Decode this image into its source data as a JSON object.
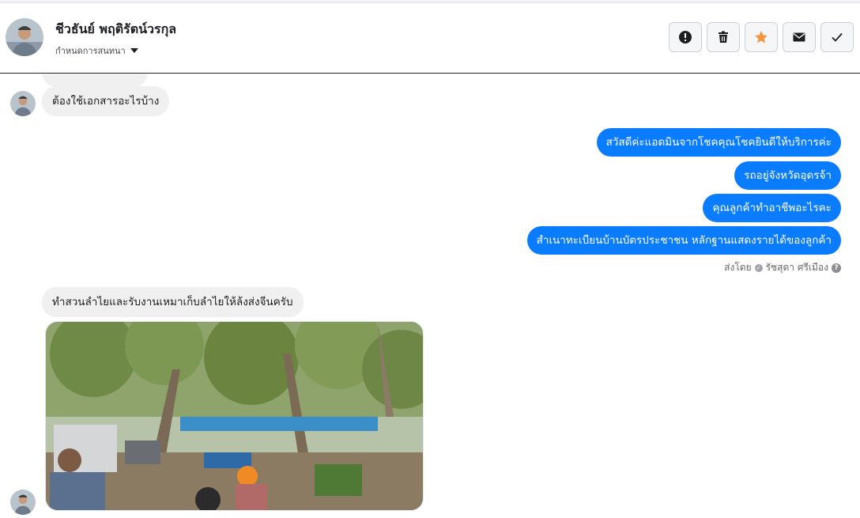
{
  "header": {
    "name": "ชีวธันย์ พฤติรัตน์วรกุล",
    "conversation_settings": "กำหนดการสนทนา"
  },
  "actions": [
    {
      "name": "report-button",
      "icon": "exclamation-icon"
    },
    {
      "name": "delete-button",
      "icon": "trash-icon"
    },
    {
      "name": "star-button",
      "icon": "star-icon",
      "color": "#f7923b"
    },
    {
      "name": "mail-button",
      "icon": "envelope-icon"
    },
    {
      "name": "done-button",
      "icon": "check-icon"
    }
  ],
  "messages": {
    "incoming_1": "ต้องใช้เอกสารอะไรบ้าง",
    "outgoing": [
      "สวัสดีค่ะแอดมินจากโชคคุณโชคยินดีให้บริการค่ะ",
      "รถอยู่จังหวัดอุดรจ้า",
      "คุณลูกค้าทำอาชีพอะไรคะ",
      "สำเนาทะเบียนบ้านบัตรประชาชน  หลักฐานแสดงรายได้ของลูกค้า"
    ],
    "sent_by_label": "ส่งโดย",
    "sent_by_name": "รัชสุดา ศรีเมือง",
    "incoming_2": "ทำสวนลำไยและรับงานเหมาเก็บลำไยให้ล้งส่งจีนครับ"
  },
  "colors": {
    "outgoing_bubble": "#0a7cff",
    "incoming_bubble": "#f0f0f0",
    "star": "#f7923b"
  }
}
